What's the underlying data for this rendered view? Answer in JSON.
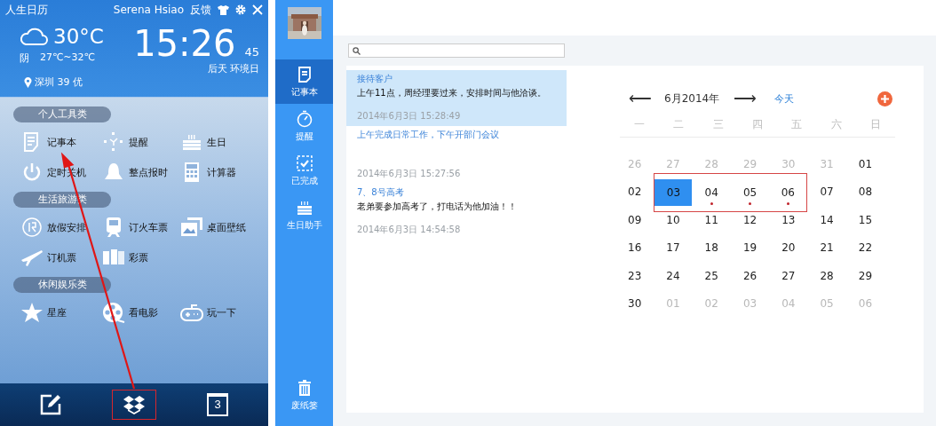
{
  "widget": {
    "title": "人生日历",
    "user": "Serena Hsiao",
    "feedback": "反馈",
    "weather": {
      "temp": "30°C",
      "condition": "阴",
      "range": "27℃~32℃",
      "city": "深圳 39 优"
    },
    "clock": {
      "time": "15:26",
      "seconds": "45",
      "note": "后天 环境日"
    },
    "sections": [
      {
        "title": "个人工具类",
        "items": [
          {
            "label": "记事本",
            "kind": "notepad"
          },
          {
            "label": "提醒",
            "kind": "remind"
          },
          {
            "label": "生日",
            "kind": "cake"
          },
          {
            "label": "定时关机",
            "kind": "power"
          },
          {
            "label": "整点报时",
            "kind": "bell"
          },
          {
            "label": "计算器",
            "kind": "calculator"
          }
        ]
      },
      {
        "title": "生活旅游类",
        "items": [
          {
            "label": "放假安排",
            "kind": "holiday"
          },
          {
            "label": "订火车票",
            "kind": "train"
          },
          {
            "label": "桌面壁纸",
            "kind": "wallpaper"
          },
          {
            "label": "订机票",
            "kind": "plane"
          },
          {
            "label": "彩票",
            "kind": "ticket"
          }
        ]
      },
      {
        "title": "休闲娱乐类",
        "items": [
          {
            "label": "星座",
            "kind": "star"
          },
          {
            "label": "看电影",
            "kind": "film"
          },
          {
            "label": "玩一下",
            "kind": "gamepad"
          }
        ]
      }
    ],
    "bottom_bar": [
      {
        "kind": "edit",
        "boxed": false
      },
      {
        "kind": "box",
        "boxed": true
      },
      {
        "kind": "calendar",
        "day": "3",
        "boxed": false
      }
    ]
  },
  "app": {
    "sidebar": [
      {
        "label": "记事本",
        "kind": "notepad",
        "selected": true
      },
      {
        "label": "提醒",
        "kind": "timer",
        "selected": false
      },
      {
        "label": "已完成",
        "kind": "done",
        "selected": false
      },
      {
        "label": "生日助手",
        "kind": "cake",
        "selected": false
      },
      {
        "label": "废纸篓",
        "kind": "trash",
        "selected": false
      }
    ],
    "notes": [
      {
        "title": "接待客户",
        "body": "上午11点，周经理要过来，安排时间与他洽谈。",
        "time": "2014年6月3日 15:28:49",
        "selected": true
      },
      {
        "title": "上午完成日常工作，下午开部门会议",
        "time": "2014年6月3日 15:27:56",
        "selected": false
      },
      {
        "title": "7、8号高考",
        "body": "老弟要参加高考了，打电话为他加油！！",
        "time": "2014年6月3日 14:54:58",
        "selected": false
      }
    ],
    "calendar": {
      "prev": "⟵",
      "month": "6月2014年",
      "next": "⟶",
      "today": "今天",
      "weekdays": [
        "一",
        "二",
        "三",
        "四",
        "五",
        "六",
        "日"
      ],
      "weeks": [
        [
          {
            "day": "26",
            "other_month": true,
            "selected": false,
            "event": false,
            "boxed": false
          },
          {
            "day": "27",
            "other_month": true,
            "selected": false,
            "event": false,
            "boxed": false
          },
          {
            "day": "28",
            "other_month": true,
            "selected": false,
            "event": false,
            "boxed": false
          },
          {
            "day": "29",
            "other_month": true,
            "selected": false,
            "event": false,
            "boxed": false
          },
          {
            "day": "30",
            "other_month": true,
            "selected": false,
            "event": false,
            "boxed": false
          },
          {
            "day": "31",
            "other_month": true,
            "selected": false,
            "event": false,
            "boxed": false
          },
          {
            "day": "01",
            "other_month": false,
            "selected": false,
            "event": false,
            "boxed": false
          }
        ],
        [
          {
            "day": "02",
            "other_month": false,
            "selected": false,
            "event": false,
            "boxed": false
          },
          {
            "day": "03",
            "other_month": false,
            "selected": true,
            "event": false,
            "boxed": true
          },
          {
            "day": "04",
            "other_month": false,
            "selected": false,
            "event": true,
            "boxed": true
          },
          {
            "day": "05",
            "other_month": false,
            "selected": false,
            "event": true,
            "boxed": true
          },
          {
            "day": "06",
            "other_month": false,
            "selected": false,
            "event": true,
            "boxed": true
          },
          {
            "day": "07",
            "other_month": false,
            "selected": false,
            "event": false,
            "boxed": false
          },
          {
            "day": "08",
            "other_month": false,
            "selected": false,
            "event": false,
            "boxed": false
          }
        ],
        [
          {
            "day": "09",
            "other_month": false,
            "selected": false,
            "event": false,
            "boxed": false
          },
          {
            "day": "10",
            "other_month": false,
            "selected": false,
            "event": false,
            "boxed": false
          },
          {
            "day": "11",
            "other_month": false,
            "selected": false,
            "event": false,
            "boxed": false
          },
          {
            "day": "12",
            "other_month": false,
            "selected": false,
            "event": false,
            "boxed": false
          },
          {
            "day": "13",
            "other_month": false,
            "selected": false,
            "event": false,
            "boxed": false
          },
          {
            "day": "14",
            "other_month": false,
            "selected": false,
            "event": false,
            "boxed": false
          },
          {
            "day": "15",
            "other_month": false,
            "selected": false,
            "event": false,
            "boxed": false
          }
        ],
        [
          {
            "day": "16",
            "other_month": false,
            "selected": false,
            "event": false,
            "boxed": false
          },
          {
            "day": "17",
            "other_month": false,
            "selected": false,
            "event": false,
            "boxed": false
          },
          {
            "day": "18",
            "other_month": false,
            "selected": false,
            "event": false,
            "boxed": false
          },
          {
            "day": "19",
            "other_month": false,
            "selected": false,
            "event": false,
            "boxed": false
          },
          {
            "day": "20",
            "other_month": false,
            "selected": false,
            "event": false,
            "boxed": false
          },
          {
            "day": "21",
            "other_month": false,
            "selected": false,
            "event": false,
            "boxed": false
          },
          {
            "day": "22",
            "other_month": false,
            "selected": false,
            "event": false,
            "boxed": false
          }
        ],
        [
          {
            "day": "23",
            "other_month": false,
            "selected": false,
            "event": false,
            "boxed": false
          },
          {
            "day": "24",
            "other_month": false,
            "selected": false,
            "event": false,
            "boxed": false
          },
          {
            "day": "25",
            "other_month": false,
            "selected": false,
            "event": false,
            "boxed": false
          },
          {
            "day": "26",
            "other_month": false,
            "selected": false,
            "event": false,
            "boxed": false
          },
          {
            "day": "27",
            "other_month": false,
            "selected": false,
            "event": false,
            "boxed": false
          },
          {
            "day": "28",
            "other_month": false,
            "selected": false,
            "event": false,
            "boxed": false
          },
          {
            "day": "29",
            "other_month": false,
            "selected": false,
            "event": false,
            "boxed": false
          }
        ],
        [
          {
            "day": "30",
            "other_month": false,
            "selected": false,
            "event": false,
            "boxed": false
          },
          {
            "day": "01",
            "other_month": true,
            "selected": false,
            "event": false,
            "boxed": false
          },
          {
            "day": "02",
            "other_month": true,
            "selected": false,
            "event": false,
            "boxed": false
          },
          {
            "day": "03",
            "other_month": true,
            "selected": false,
            "event": false,
            "boxed": false
          },
          {
            "day": "04",
            "other_month": true,
            "selected": false,
            "event": false,
            "boxed": false
          },
          {
            "day": "05",
            "other_month": true,
            "selected": false,
            "event": false,
            "boxed": false
          },
          {
            "day": "06",
            "other_month": true,
            "selected": false,
            "event": false,
            "boxed": false
          }
        ]
      ]
    }
  }
}
